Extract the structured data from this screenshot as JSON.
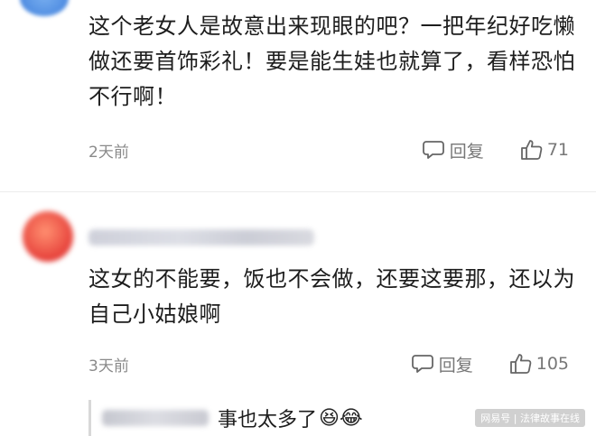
{
  "comments": [
    {
      "text": "这个老女人是故意出来现眼的吧？一把年纪好吃懒做还要首饰彩礼！要是能生娃也就算了，看样恐怕不行啊！",
      "time": "2天前",
      "reply_label": "回复",
      "likes": "71"
    },
    {
      "text": "这女的不能要，饭也不会做，还要这要那，还以为自己小姑娘啊",
      "time": "3天前",
      "reply_label": "回复",
      "likes": "105",
      "quote": {
        "text": "事也太多了",
        "emoji": "😆😂"
      }
    }
  ],
  "watermark": "网易号 | 法律故事在线",
  "icons": {
    "reply": "comment-bubble-icon",
    "like": "thumbs-up-icon"
  }
}
